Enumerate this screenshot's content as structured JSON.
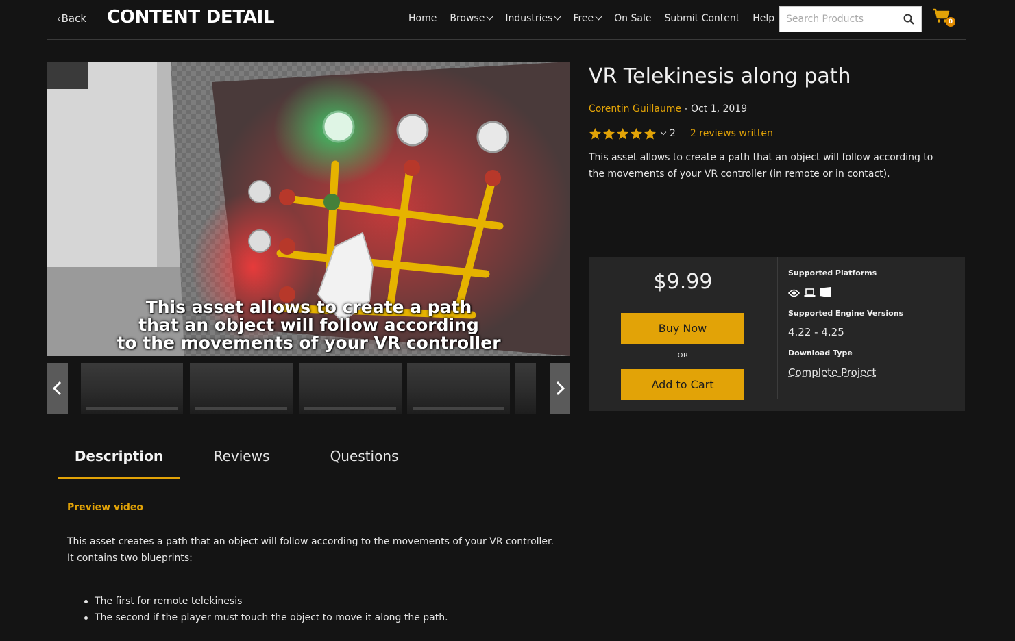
{
  "header": {
    "back_label": "Back",
    "page_title": "CONTENT DETAIL",
    "nav": [
      {
        "label": "Home",
        "dropdown": false
      },
      {
        "label": "Browse",
        "dropdown": true
      },
      {
        "label": "Industries",
        "dropdown": true
      },
      {
        "label": "Free",
        "dropdown": true
      },
      {
        "label": "On Sale",
        "dropdown": false
      },
      {
        "label": "Submit Content",
        "dropdown": false
      },
      {
        "label": "Help",
        "dropdown": false
      }
    ],
    "search_placeholder": "Search Products",
    "cart_count": "0"
  },
  "gallery": {
    "caption_lines": [
      "This asset allows to create a path",
      "that an object will follow according",
      "to the movements of your VR controller"
    ]
  },
  "product": {
    "title": "VR Telekinesis along path",
    "author": "Corentin Guillaume",
    "date_separator": " - ",
    "date": "Oct 1, 2019",
    "rating_stars": 5,
    "rating_count": "2",
    "reviews_link": "2 reviews written",
    "summary": "This asset allows to create a path that an object will follow according to the movements of your VR controller (in remote or in contact)."
  },
  "purchase": {
    "price": "$9.99",
    "buy_now": "Buy Now",
    "or": "OR",
    "add_to_cart": "Add to Cart",
    "platforms_label": "Supported Platforms",
    "platform_icons": [
      "eye-icon",
      "laptop-icon",
      "windows-icon"
    ],
    "engine_label": "Supported Engine Versions",
    "engine_versions": "4.22 - 4.25",
    "download_label": "Download Type",
    "download_type": "Complete Project"
  },
  "tabs": [
    "Description",
    "Reviews",
    "Questions"
  ],
  "description": {
    "heading": "Preview video",
    "line1": "This asset creates a path that an object will follow according to the movements of your VR controller.",
    "line2": "It contains two blueprints:",
    "bullets": [
      "The first for remote telekinesis",
      "The second if the player must touch the object to move it along the path."
    ]
  },
  "colors": {
    "accent": "#e2a307",
    "background": "#141414",
    "panel": "#262626"
  }
}
